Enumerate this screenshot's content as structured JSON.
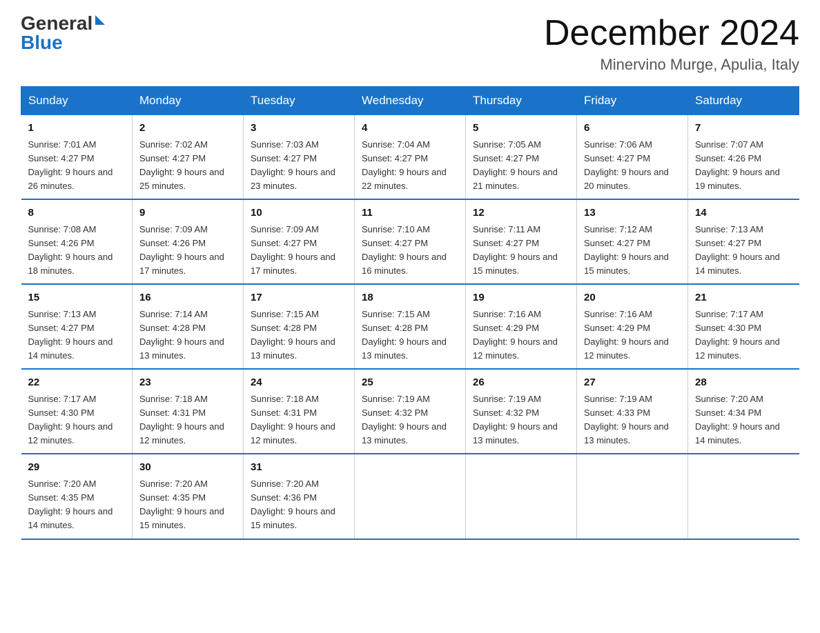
{
  "header": {
    "logo_general": "General",
    "logo_blue": "Blue",
    "month_title": "December 2024",
    "location": "Minervino Murge, Apulia, Italy"
  },
  "days_of_week": [
    "Sunday",
    "Monday",
    "Tuesday",
    "Wednesday",
    "Thursday",
    "Friday",
    "Saturday"
  ],
  "weeks": [
    [
      {
        "day": "1",
        "sunrise": "Sunrise: 7:01 AM",
        "sunset": "Sunset: 4:27 PM",
        "daylight": "Daylight: 9 hours and 26 minutes."
      },
      {
        "day": "2",
        "sunrise": "Sunrise: 7:02 AM",
        "sunset": "Sunset: 4:27 PM",
        "daylight": "Daylight: 9 hours and 25 minutes."
      },
      {
        "day": "3",
        "sunrise": "Sunrise: 7:03 AM",
        "sunset": "Sunset: 4:27 PM",
        "daylight": "Daylight: 9 hours and 23 minutes."
      },
      {
        "day": "4",
        "sunrise": "Sunrise: 7:04 AM",
        "sunset": "Sunset: 4:27 PM",
        "daylight": "Daylight: 9 hours and 22 minutes."
      },
      {
        "day": "5",
        "sunrise": "Sunrise: 7:05 AM",
        "sunset": "Sunset: 4:27 PM",
        "daylight": "Daylight: 9 hours and 21 minutes."
      },
      {
        "day": "6",
        "sunrise": "Sunrise: 7:06 AM",
        "sunset": "Sunset: 4:27 PM",
        "daylight": "Daylight: 9 hours and 20 minutes."
      },
      {
        "day": "7",
        "sunrise": "Sunrise: 7:07 AM",
        "sunset": "Sunset: 4:26 PM",
        "daylight": "Daylight: 9 hours and 19 minutes."
      }
    ],
    [
      {
        "day": "8",
        "sunrise": "Sunrise: 7:08 AM",
        "sunset": "Sunset: 4:26 PM",
        "daylight": "Daylight: 9 hours and 18 minutes."
      },
      {
        "day": "9",
        "sunrise": "Sunrise: 7:09 AM",
        "sunset": "Sunset: 4:26 PM",
        "daylight": "Daylight: 9 hours and 17 minutes."
      },
      {
        "day": "10",
        "sunrise": "Sunrise: 7:09 AM",
        "sunset": "Sunset: 4:27 PM",
        "daylight": "Daylight: 9 hours and 17 minutes."
      },
      {
        "day": "11",
        "sunrise": "Sunrise: 7:10 AM",
        "sunset": "Sunset: 4:27 PM",
        "daylight": "Daylight: 9 hours and 16 minutes."
      },
      {
        "day": "12",
        "sunrise": "Sunrise: 7:11 AM",
        "sunset": "Sunset: 4:27 PM",
        "daylight": "Daylight: 9 hours and 15 minutes."
      },
      {
        "day": "13",
        "sunrise": "Sunrise: 7:12 AM",
        "sunset": "Sunset: 4:27 PM",
        "daylight": "Daylight: 9 hours and 15 minutes."
      },
      {
        "day": "14",
        "sunrise": "Sunrise: 7:13 AM",
        "sunset": "Sunset: 4:27 PM",
        "daylight": "Daylight: 9 hours and 14 minutes."
      }
    ],
    [
      {
        "day": "15",
        "sunrise": "Sunrise: 7:13 AM",
        "sunset": "Sunset: 4:27 PM",
        "daylight": "Daylight: 9 hours and 14 minutes."
      },
      {
        "day": "16",
        "sunrise": "Sunrise: 7:14 AM",
        "sunset": "Sunset: 4:28 PM",
        "daylight": "Daylight: 9 hours and 13 minutes."
      },
      {
        "day": "17",
        "sunrise": "Sunrise: 7:15 AM",
        "sunset": "Sunset: 4:28 PM",
        "daylight": "Daylight: 9 hours and 13 minutes."
      },
      {
        "day": "18",
        "sunrise": "Sunrise: 7:15 AM",
        "sunset": "Sunset: 4:28 PM",
        "daylight": "Daylight: 9 hours and 13 minutes."
      },
      {
        "day": "19",
        "sunrise": "Sunrise: 7:16 AM",
        "sunset": "Sunset: 4:29 PM",
        "daylight": "Daylight: 9 hours and 12 minutes."
      },
      {
        "day": "20",
        "sunrise": "Sunrise: 7:16 AM",
        "sunset": "Sunset: 4:29 PM",
        "daylight": "Daylight: 9 hours and 12 minutes."
      },
      {
        "day": "21",
        "sunrise": "Sunrise: 7:17 AM",
        "sunset": "Sunset: 4:30 PM",
        "daylight": "Daylight: 9 hours and 12 minutes."
      }
    ],
    [
      {
        "day": "22",
        "sunrise": "Sunrise: 7:17 AM",
        "sunset": "Sunset: 4:30 PM",
        "daylight": "Daylight: 9 hours and 12 minutes."
      },
      {
        "day": "23",
        "sunrise": "Sunrise: 7:18 AM",
        "sunset": "Sunset: 4:31 PM",
        "daylight": "Daylight: 9 hours and 12 minutes."
      },
      {
        "day": "24",
        "sunrise": "Sunrise: 7:18 AM",
        "sunset": "Sunset: 4:31 PM",
        "daylight": "Daylight: 9 hours and 12 minutes."
      },
      {
        "day": "25",
        "sunrise": "Sunrise: 7:19 AM",
        "sunset": "Sunset: 4:32 PM",
        "daylight": "Daylight: 9 hours and 13 minutes."
      },
      {
        "day": "26",
        "sunrise": "Sunrise: 7:19 AM",
        "sunset": "Sunset: 4:32 PM",
        "daylight": "Daylight: 9 hours and 13 minutes."
      },
      {
        "day": "27",
        "sunrise": "Sunrise: 7:19 AM",
        "sunset": "Sunset: 4:33 PM",
        "daylight": "Daylight: 9 hours and 13 minutes."
      },
      {
        "day": "28",
        "sunrise": "Sunrise: 7:20 AM",
        "sunset": "Sunset: 4:34 PM",
        "daylight": "Daylight: 9 hours and 14 minutes."
      }
    ],
    [
      {
        "day": "29",
        "sunrise": "Sunrise: 7:20 AM",
        "sunset": "Sunset: 4:35 PM",
        "daylight": "Daylight: 9 hours and 14 minutes."
      },
      {
        "day": "30",
        "sunrise": "Sunrise: 7:20 AM",
        "sunset": "Sunset: 4:35 PM",
        "daylight": "Daylight: 9 hours and 15 minutes."
      },
      {
        "day": "31",
        "sunrise": "Sunrise: 7:20 AM",
        "sunset": "Sunset: 4:36 PM",
        "daylight": "Daylight: 9 hours and 15 minutes."
      },
      {
        "day": "",
        "sunrise": "",
        "sunset": "",
        "daylight": ""
      },
      {
        "day": "",
        "sunrise": "",
        "sunset": "",
        "daylight": ""
      },
      {
        "day": "",
        "sunrise": "",
        "sunset": "",
        "daylight": ""
      },
      {
        "day": "",
        "sunrise": "",
        "sunset": "",
        "daylight": ""
      }
    ]
  ]
}
